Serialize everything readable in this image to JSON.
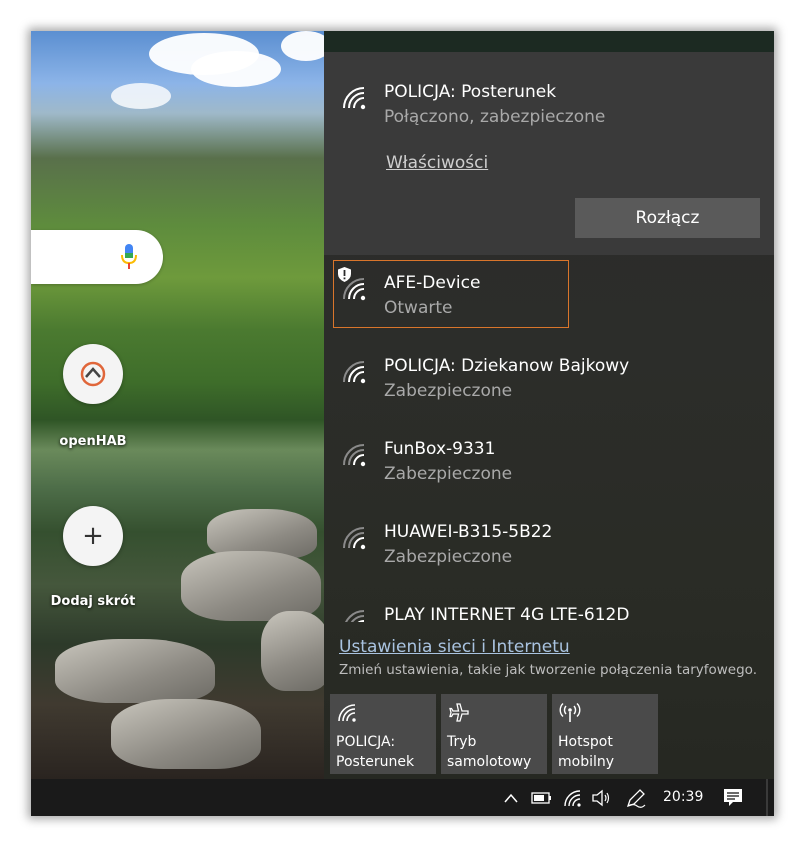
{
  "browser": {
    "search_placeholder": "",
    "shortcuts": [
      {
        "label": "openHAB",
        "icon": "openhab-logo-icon"
      },
      {
        "label": "Dodaj skrót",
        "icon": "plus-icon"
      }
    ]
  },
  "flyout": {
    "connected": {
      "name": "POLICJA: Posterunek",
      "status": "Połączono, zabezpieczone",
      "properties_link": "Właściwości",
      "disconnect_button": "Rozłącz"
    },
    "networks": [
      {
        "name": "AFE-Device",
        "status": "Otwarte",
        "open": true,
        "selected": true
      },
      {
        "name": "POLICJA: Dziekanow Bajkowy",
        "status": "Zabezpieczone",
        "open": false,
        "selected": false
      },
      {
        "name": "FunBox-9331",
        "status": "Zabezpieczone",
        "open": false,
        "selected": false
      },
      {
        "name": "HUAWEI-B315-5B22",
        "status": "Zabezpieczone",
        "open": false,
        "selected": false
      },
      {
        "name": "PLAY INTERNET 4G LTE-612D",
        "status": "",
        "open": false,
        "selected": false
      }
    ],
    "settings_link": "Ustawienia sieci i Internetu",
    "settings_description": "Zmień ustawienia, takie jak tworzenie połączenia taryfowego.",
    "quick_actions": [
      {
        "line1": "POLICJA:",
        "line2": "Posterunek",
        "icon": "wifi-icon"
      },
      {
        "line1": "Tryb",
        "line2": "samolotowy",
        "icon": "airplane-icon"
      },
      {
        "line1": "Hotspot",
        "line2": "mobilny",
        "icon": "hotspot-icon"
      }
    ]
  },
  "taskbar": {
    "time": "20:39",
    "icons": [
      "chevron-up-icon",
      "battery-icon",
      "wifi-icon",
      "speaker-icon",
      "pen-icon",
      "action-center-icon"
    ]
  },
  "colors": {
    "accent_selected_border": "#d9752b",
    "flyout_bg": "#2b2b2b",
    "link_blue": "#a9c3e0"
  }
}
